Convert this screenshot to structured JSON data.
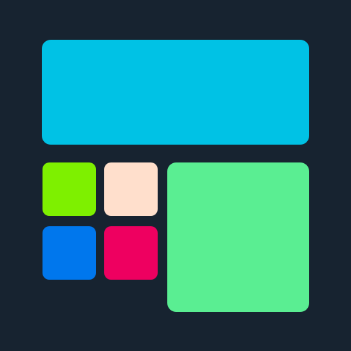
{
  "colors": {
    "background": "#172330",
    "top_banner": "#00c2e5",
    "small_tile_green": "#7ef000",
    "small_tile_peach": "#ffdfcc",
    "small_tile_blue": "#0077ed",
    "small_tile_pink": "#ee0060",
    "large_tile_green": "#5aee92"
  },
  "icons": {
    "grid": "dashboard-grid-icon"
  }
}
